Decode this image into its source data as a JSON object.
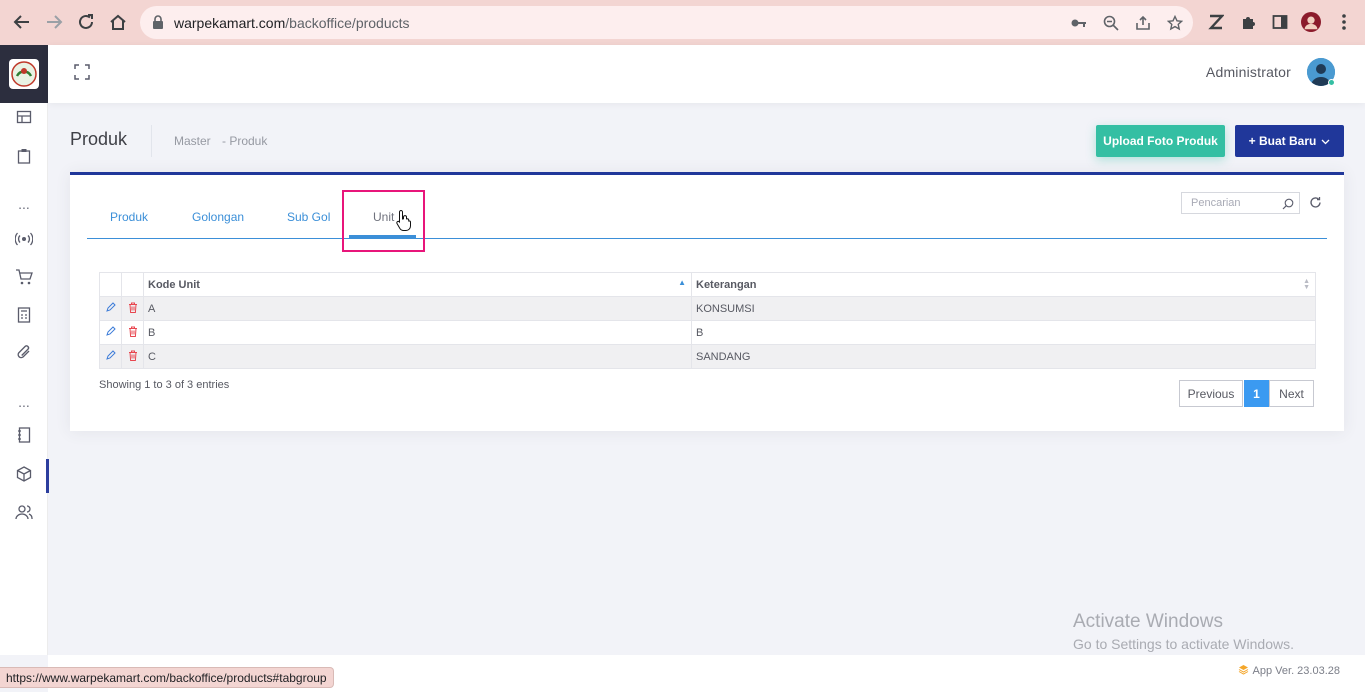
{
  "browser": {
    "url_host": "warpekamart.com",
    "url_path": "/backoffice/products",
    "status_url": "https://www.warpekamart.com/backoffice/products#tabgroup"
  },
  "header": {
    "admin_name": "Administrator"
  },
  "subheader": {
    "title": "Produk",
    "breadcrumb": [
      "Master",
      "- Produk"
    ],
    "upload_button": "Upload Foto Produk",
    "new_button": "+ Buat Baru"
  },
  "tabs": [
    {
      "label": "Produk",
      "active": false
    },
    {
      "label": "Golongan",
      "active": false
    },
    {
      "label": "Sub Gol",
      "active": false
    },
    {
      "label": "Unit",
      "active": true
    }
  ],
  "search": {
    "placeholder": "Pencarian"
  },
  "table": {
    "columns": [
      "Kode Unit",
      "Keterangan"
    ],
    "rows": [
      {
        "kode": "A",
        "keterangan": "KONSUMSI"
      },
      {
        "kode": "B",
        "keterangan": "B"
      },
      {
        "kode": "C",
        "keterangan": "SANDANG"
      }
    ],
    "info": "Showing 1 to 3 of 3 entries"
  },
  "pagination": {
    "previous": "Previous",
    "current": "1",
    "next": "Next"
  },
  "watermark": {
    "title": "Activate Windows",
    "subtitle": "Go to Settings to activate Windows."
  },
  "footer": {
    "version": "App Ver. 23.03.28"
  },
  "colors": {
    "primary": "#20379a",
    "success": "#34bfa3",
    "accent": "#3b8fd8",
    "highlight": "#e8157a"
  }
}
